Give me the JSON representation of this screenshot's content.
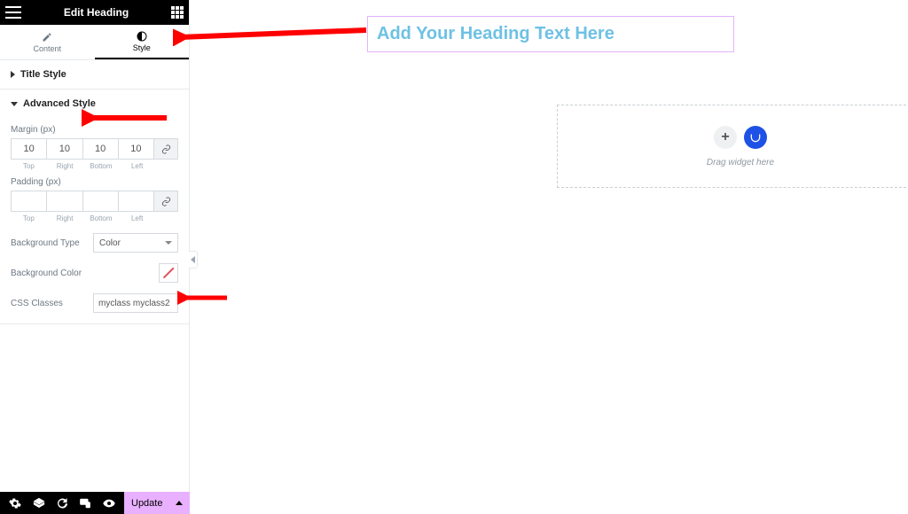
{
  "sidebar": {
    "title": "Edit Heading",
    "tabs": {
      "content": "Content",
      "style": "Style"
    },
    "sections": {
      "title_style": "Title Style",
      "advanced_style": "Advanced Style"
    },
    "margin": {
      "label": "Margin (px)",
      "top": "10",
      "right": "10",
      "bottom": "10",
      "left": "10",
      "sub": {
        "top": "Top",
        "right": "Right",
        "bottom": "Bottom",
        "left": "Left"
      }
    },
    "padding": {
      "label": "Padding (px)",
      "top": "",
      "right": "",
      "bottom": "",
      "left": "",
      "sub": {
        "top": "Top",
        "right": "Right",
        "bottom": "Bottom",
        "left": "Left"
      }
    },
    "bg_type": {
      "label": "Background Type",
      "value": "Color"
    },
    "bg_color": {
      "label": "Background Color"
    },
    "css_classes": {
      "label": "CSS Classes",
      "value": "myclass myclass2"
    },
    "update": "Update"
  },
  "canvas": {
    "heading_text": "Add Your Heading Text Here",
    "dropzone_text": "Drag widget here"
  }
}
